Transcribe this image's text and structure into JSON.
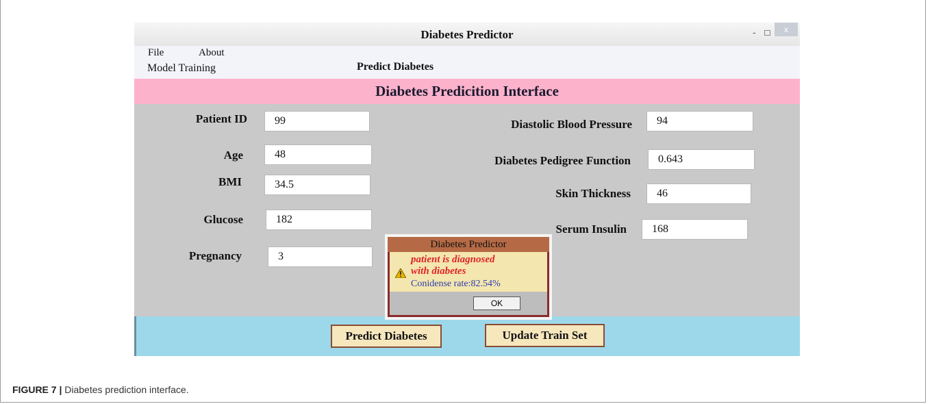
{
  "window": {
    "title": "Diabetes Predictor",
    "controls": {
      "minimize": "-",
      "close": "x"
    }
  },
  "menu": {
    "file": "File",
    "about": "About",
    "model_training": "Model Training",
    "predict_diabetes": "Predict Diabetes"
  },
  "banner": "Diabetes Predicition Interface",
  "form": {
    "patient_id": {
      "label": "Patient ID",
      "value": "99"
    },
    "age": {
      "label": "Age",
      "value": "48"
    },
    "bmi": {
      "label": "BMI",
      "value": "34.5"
    },
    "glucose": {
      "label": "Glucose",
      "value": "182"
    },
    "pregnancy": {
      "label": "Pregnancy",
      "value": "3"
    },
    "diastolic_bp": {
      "label": "Diastolic Blood Pressure",
      "value": "94"
    },
    "pedigree": {
      "label": "Diabetes Pedigree Function",
      "value": "0.643"
    },
    "skin_thickness": {
      "label": "Skin Thickness",
      "value": "46"
    },
    "serum_insulin": {
      "label": "Serum Insulin",
      "value": "168"
    }
  },
  "buttons": {
    "predict": "Predict Diabetes",
    "update": "Update Train Set"
  },
  "dialog": {
    "title": "Diabetes Predictor",
    "message_line1": "patient is diagnosed",
    "message_line2": "with diabetes",
    "confidence": "Conidense rate:82.54%",
    "ok": "OK",
    "icon": "warning-icon"
  },
  "caption": {
    "label": "FIGURE 7 |",
    "text": " Diabetes prediction interface."
  },
  "colors": {
    "banner": "#fdb2cc",
    "form_bg": "#c9c9c9",
    "bottom_bar": "#9dd8ea",
    "button_bg": "#f6e7bd",
    "dialog_frame": "#8b2a2a",
    "dialog_title": "#b56a45",
    "message_red": "#e0232a",
    "confidence_blue": "#2d3cb0"
  }
}
